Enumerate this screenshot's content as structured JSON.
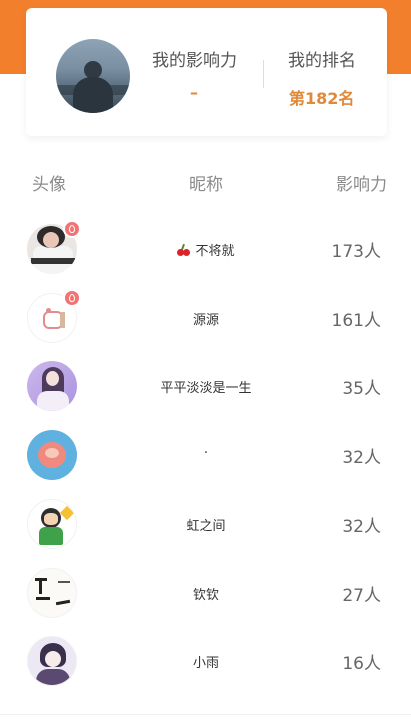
{
  "summary": {
    "influence_label": "我的影响力",
    "influence_value": "–",
    "rank_label": "我的排名",
    "rank_value": "第182名"
  },
  "table": {
    "headers": {
      "avatar": "头像",
      "nickname": "昵称",
      "influence": "影响力"
    },
    "rows": [
      {
        "nickname": "不将就",
        "influence": "173人",
        "badge": true,
        "emoji_icon": "cherry-icon"
      },
      {
        "nickname": "源源",
        "influence": "161人",
        "badge": true
      },
      {
        "nickname": "平平淡淡是一生",
        "influence": "35人",
        "badge": false
      },
      {
        "nickname": "·",
        "influence": "32人",
        "badge": false
      },
      {
        "nickname": "虹之间",
        "influence": "32人",
        "badge": false
      },
      {
        "nickname": "钦钦",
        "influence": "27人",
        "badge": false
      },
      {
        "nickname": "小雨",
        "influence": "16人",
        "badge": false
      }
    ]
  },
  "colors": {
    "brand_orange": "#f27f2c",
    "rank_text": "#e0893a",
    "badge_red": "#f27373"
  }
}
